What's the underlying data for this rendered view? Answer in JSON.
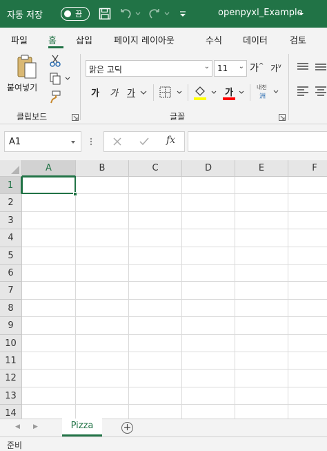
{
  "titlebar": {
    "autosave_label": "자동 저장",
    "autosave_state": "끔",
    "filename": "openpyxl_Example",
    "icons": [
      "save-icon",
      "undo-icon",
      "redo-icon",
      "customize-qat-icon"
    ]
  },
  "tabs": [
    "파일",
    "홈",
    "삽입",
    "페이지 레이아웃",
    "수식",
    "데이터",
    "검토"
  ],
  "active_tab": "홈",
  "ribbon": {
    "clipboard": {
      "paste_label": "붙여넣기",
      "group_label": "클립보드"
    },
    "font": {
      "font_name": "맑은 고딕",
      "font_size": "11",
      "grow_font": "가",
      "shrink_font": "가",
      "bold": "가",
      "italic": "가",
      "underline": "가",
      "font_color_glyph": "가",
      "phonetic_top": "내천",
      "phonetic_bottom": "洲",
      "group_label": "글꼴",
      "highlight_color": "#ffff00",
      "font_color": "#ff0000"
    }
  },
  "formula_bar": {
    "name_box": "A1",
    "fx_label": "fx",
    "formula_value": ""
  },
  "grid": {
    "columns": [
      "A",
      "B",
      "C",
      "D",
      "E",
      "F"
    ],
    "rows": [
      "1",
      "2",
      "3",
      "4",
      "5",
      "6",
      "7",
      "8",
      "9",
      "10",
      "11",
      "12",
      "13",
      "14"
    ],
    "active_cell": "A1"
  },
  "sheets": {
    "tabs": [
      "Pizza"
    ],
    "active": "Pizza",
    "add_label": "+"
  },
  "status": {
    "text": "준비"
  },
  "colors": {
    "accent": "#217346",
    "chrome": "#f3f3f3"
  }
}
